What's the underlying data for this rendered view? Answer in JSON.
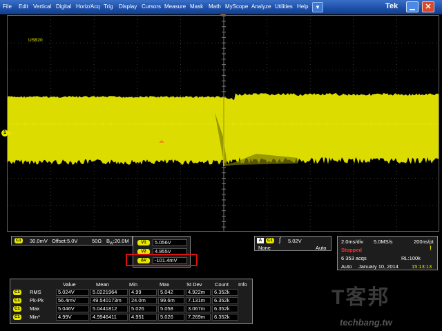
{
  "menu": {
    "items": [
      "File",
      "Edit",
      "Vertical",
      "Digital",
      "Horiz/Acq",
      "Trig",
      "Display",
      "Cursors",
      "Measure",
      "Mask",
      "Math",
      "MyScope",
      "Analyze",
      "Utilities",
      "Help"
    ],
    "dropdown_symbol": "▼",
    "brand": "Tek",
    "close_symbol": "✕"
  },
  "graticule": {
    "label": "USB20",
    "ch_marker": "1"
  },
  "channel_info": {
    "badge": "C1",
    "scale": "30.0mV",
    "offset": "Offset:5.0V",
    "impedance": "50Ω",
    "bw_prefix": "B",
    "bw_sub": "W",
    "bw_value": ":20.0M"
  },
  "cursors": {
    "v1_badge": "V1",
    "v1_value": "5.056V",
    "v2_badge": "V2",
    "v2_value": "4.955V",
    "dv_badge": "ΔV",
    "dv_value": "-101.4mV"
  },
  "trigger": {
    "a_badge": "A",
    "ch_badge": "C1",
    "edge_symbol": "∫",
    "level": "5.02V",
    "coupling": "None",
    "mode": "Auto"
  },
  "acquisition": {
    "horizontal": "2.0ms/div",
    "sample_rate": "5.0MS/s",
    "resolution": "200ns/pt",
    "state": "Stopped",
    "acqs": "6 353 acqs",
    "record_length": "RL:100k",
    "run_mode": "Auto",
    "date": "January 10, 2014",
    "time": "15:13:13",
    "alert_symbol": "!"
  },
  "measurements": {
    "headers": [
      "Value",
      "Mean",
      "Min",
      "Max",
      "St Dev",
      "Count",
      "Info"
    ],
    "rows": [
      {
        "badge": "C1",
        "name": "RMS",
        "cells": [
          "5.024V",
          "5.0221964",
          "4.99",
          "5.042",
          "4.922m",
          "6.352k"
        ]
      },
      {
        "badge": "C1",
        "name": "Pk-Pk",
        "cells": [
          "56.4mV",
          "49.540173m",
          "24.0m",
          "99.6m",
          "7.131m",
          "6.352k"
        ]
      },
      {
        "badge": "C1",
        "name": "Max",
        "cells": [
          "5.046V",
          "5.0441812",
          "5.026",
          "5.058",
          "3.067m",
          "6.352k"
        ]
      },
      {
        "badge": "C1",
        "name": "Min*",
        "cells": [
          "4.99V",
          "4.9946411",
          "4.951",
          "5.026",
          "7.269m",
          "6.352k"
        ]
      }
    ]
  },
  "watermark": {
    "text": "T客邦",
    "url": "techbang.tw"
  },
  "colors": {
    "trace": "#e8e800",
    "menubar": "#1c4fa8",
    "highlight": "#e01010"
  }
}
